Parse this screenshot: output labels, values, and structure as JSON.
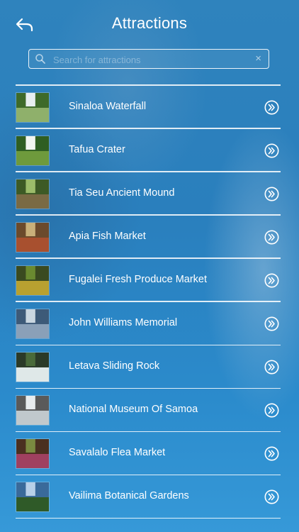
{
  "header": {
    "title": "Attractions",
    "back_icon": "back-arrow-icon"
  },
  "search": {
    "placeholder": "Search for attractions",
    "value": "",
    "icon": "search-icon",
    "clear_icon": "×"
  },
  "attractions": [
    {
      "name": "Sinaloa Waterfall",
      "thumb_colors": [
        "#3e6a2a",
        "#8fb06b",
        "#e8eef0"
      ]
    },
    {
      "name": "Tafua Crater",
      "thumb_colors": [
        "#2f5e22",
        "#6e9a3c",
        "#f2f5f0"
      ]
    },
    {
      "name": "Tia Seu Ancient Mound",
      "thumb_colors": [
        "#3d5a25",
        "#7a6a44",
        "#9cbc6a"
      ]
    },
    {
      "name": "Apia Fish Market",
      "thumb_colors": [
        "#6b4a2c",
        "#a8502f",
        "#c9b07a"
      ]
    },
    {
      "name": "Fugalei Fresh Produce Market",
      "thumb_colors": [
        "#3a4a20",
        "#b8a130",
        "#6a8a30"
      ]
    },
    {
      "name": "John Williams Memorial",
      "thumb_colors": [
        "#3d5a78",
        "#8aa0b8",
        "#c9d6e0"
      ]
    },
    {
      "name": "Letava Sliding Rock",
      "thumb_colors": [
        "#2b3a28",
        "#dfe8e8",
        "#4a6a3a"
      ]
    },
    {
      "name": "National Museum Of Samoa",
      "thumb_colors": [
        "#5a5a5a",
        "#c0c8cc",
        "#e8ecee"
      ]
    },
    {
      "name": "Savalalo Flea Market",
      "thumb_colors": [
        "#4a3020",
        "#a04060",
        "#7a8a40"
      ]
    },
    {
      "name": "Vailima Botanical Gardens",
      "thumb_colors": [
        "#3a6a9a",
        "#2f5a28",
        "#b8d0e8"
      ]
    }
  ],
  "row_action_icon": "double-chevron-right-icon",
  "colors": {
    "background": "#2c86c4",
    "text": "#ffffff",
    "divider": "#ffffff"
  }
}
